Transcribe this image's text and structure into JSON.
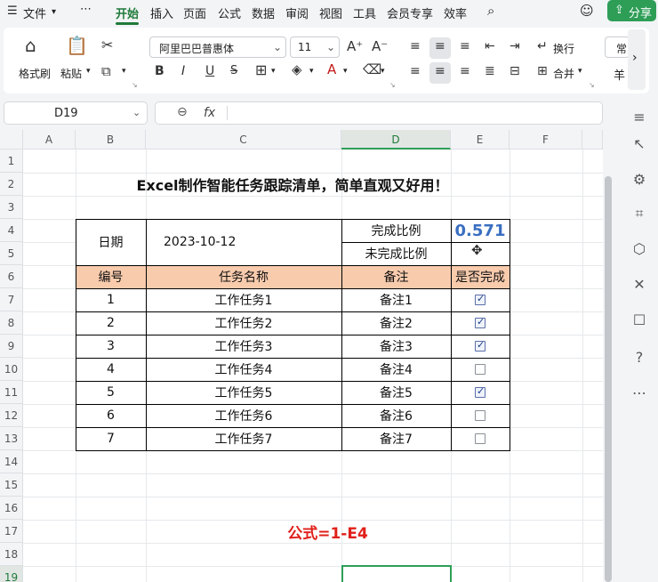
{
  "menu": {
    "file": "文件",
    "more": "⋯",
    "tabs": [
      "开始",
      "插入",
      "页面",
      "公式",
      "数据",
      "审阅",
      "视图",
      "工具",
      "会员专享",
      "效率"
    ],
    "share": "分享"
  },
  "ribbon": {
    "format_painter": "格式刷",
    "paste": "粘贴",
    "font_name": "阿里巴巴普惠体",
    "font_size": "11",
    "wrap": "换行",
    "merge": "合并",
    "normal": "常",
    "currency": "羊",
    "bold": "B",
    "italic": "I",
    "underline": "U"
  },
  "formula_bar": {
    "name_box": "D19",
    "fx": "fx",
    "formula": ""
  },
  "grid": {
    "columns": [
      "A",
      "B",
      "C",
      "D",
      "E",
      "F"
    ],
    "rows": [
      "1",
      "2",
      "3",
      "4",
      "5",
      "6",
      "7",
      "8",
      "9",
      "10",
      "11",
      "12",
      "13",
      "14",
      "15",
      "16",
      "17",
      "18",
      "19"
    ]
  },
  "sheet": {
    "title": "Excel制作智能任务跟踪清单，简单直观又好用！",
    "date_label": "日期",
    "date_value": "2023-10-12",
    "done_ratio_label": "完成比例",
    "done_ratio_value": "0.571",
    "undone_ratio_label": "未完成比例",
    "headers": [
      "编号",
      "任务名称",
      "备注",
      "是否完成"
    ],
    "tasks": [
      {
        "id": "1",
        "name": "工作任务1",
        "note": "备注1",
        "done": true
      },
      {
        "id": "2",
        "name": "工作任务2",
        "note": "备注2",
        "done": true
      },
      {
        "id": "3",
        "name": "工作任务3",
        "note": "备注3",
        "done": true
      },
      {
        "id": "4",
        "name": "工作任务4",
        "note": "备注4",
        "done": false
      },
      {
        "id": "5",
        "name": "工作任务5",
        "note": "备注5",
        "done": true
      },
      {
        "id": "6",
        "name": "工作任务6",
        "note": "备注6",
        "done": false
      },
      {
        "id": "7",
        "name": "工作任务7",
        "note": "备注7",
        "done": false
      }
    ],
    "formula_note": "公式=1-E4"
  },
  "colors": {
    "accent": "#1f7a3a",
    "header_fill": "#f8cbad",
    "ratio_value": "#3a6fc1",
    "formula_note": "#e0201a"
  }
}
